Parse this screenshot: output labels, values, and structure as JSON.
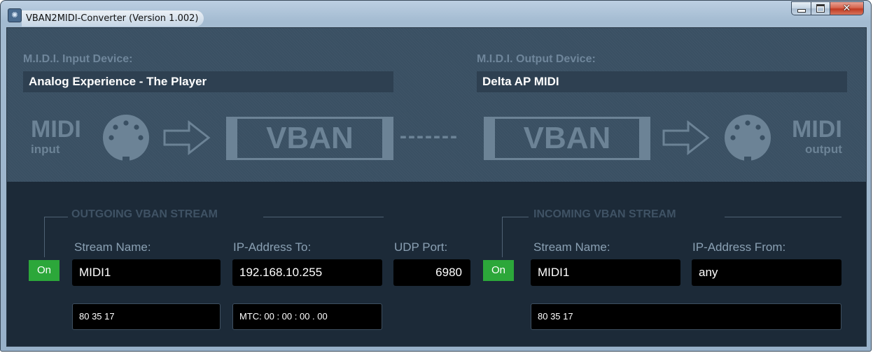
{
  "window": {
    "title": "VBAN2MIDI-Converter (Version 1.002)"
  },
  "midi_input_device": {
    "label": "M.I.D.I. Input Device:",
    "value": "Analog Experience - The Player"
  },
  "midi_output_device": {
    "label": "M.I.D.I. Output Device:",
    "value": "Delta AP MIDI"
  },
  "diagram": {
    "input_big": "MIDI",
    "input_small": "input",
    "output_big": "MIDI",
    "output_small": "output",
    "vban_left": "VBAN",
    "vban_right": "VBAN",
    "dashes": "-------"
  },
  "outgoing": {
    "title": "OUTGOING VBAN STREAM",
    "on_label": "On",
    "stream_name_label": "Stream Name:",
    "stream_name": "MIDI1",
    "ip_label": "IP-Address To:",
    "ip": "192.168.10.255",
    "port_label": "UDP Port:",
    "port": "6980",
    "midi_monitor": "80 35 17",
    "mtc": "MTC: 00 : 00 : 00 . 00"
  },
  "incoming": {
    "title": "INCOMING VBAN STREAM",
    "on_label": "On",
    "stream_name_label": "Stream Name:",
    "stream_name": "MIDI1",
    "ip_label": "IP-Address From:",
    "ip": "any",
    "midi_monitor": "80 35 17"
  },
  "colors": {
    "on_green": "#2ca73a",
    "panel_top": "#3a5063",
    "panel_bottom": "#1c2a38",
    "diagram_gray": "#6c8396"
  },
  "icons": {
    "app": "vban-app-icon",
    "midi_connector": "din-connector-icon",
    "arrow": "outline-right-arrow-icon"
  }
}
